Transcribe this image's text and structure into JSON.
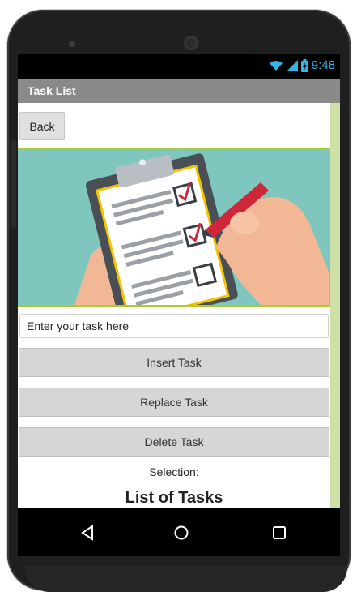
{
  "status_bar": {
    "time": "9:48",
    "icons": [
      "wifi-icon",
      "signal-icon",
      "battery-icon"
    ]
  },
  "app_bar": {
    "title": "Task List"
  },
  "buttons": {
    "back_label": "Back",
    "insert_label": "Insert Task",
    "replace_label": "Replace Task",
    "delete_label": "Delete Task"
  },
  "task_input": {
    "placeholder": "Enter your task here",
    "value": ""
  },
  "selection": {
    "label": "Selection:"
  },
  "list": {
    "heading": "List of Tasks"
  },
  "hero_image": {
    "icon": "clipboard-checklist-illustration"
  },
  "nav_bar": {
    "icons": [
      "back-triangle-icon",
      "home-circle-icon",
      "recents-square-icon"
    ]
  },
  "colors": {
    "accent": "#33b5e5",
    "title_bar": "#8a8a8a",
    "image_border": "#a6cc2e",
    "scroll_strip": "#cfe0a6"
  }
}
